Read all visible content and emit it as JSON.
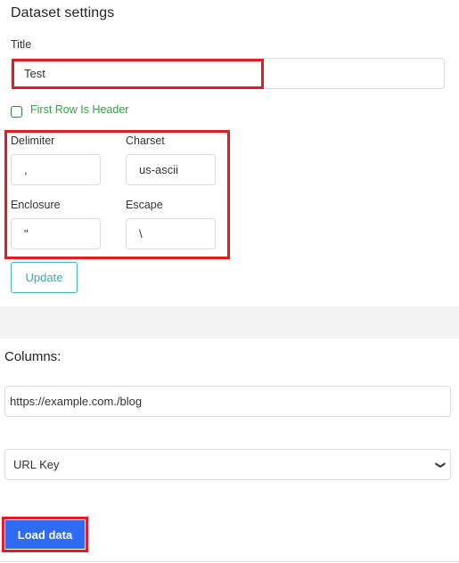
{
  "header": {
    "title": "Dataset settings"
  },
  "form": {
    "title_label": "Title",
    "title_value": "Test",
    "first_row_header_label": "First Row Is Header",
    "first_row_header_checked": false,
    "delimiter_label": "Delimiter",
    "delimiter_value": ",",
    "charset_label": "Charset",
    "charset_value": "us-ascii",
    "enclosure_label": "Enclosure",
    "enclosure_value": "\"",
    "escape_label": "Escape",
    "escape_value": "\\",
    "update_label": "Update"
  },
  "columns": {
    "label": "Columns:",
    "url_value": "https://example.com./blog",
    "select_value": "URL Key"
  },
  "actions": {
    "load_label": "Load data"
  },
  "colors": {
    "highlight": "#e31b23",
    "primary": "#2f6cf5",
    "accent_teal": "#3aa9b4",
    "checkbox_green": "#3a9c44"
  }
}
